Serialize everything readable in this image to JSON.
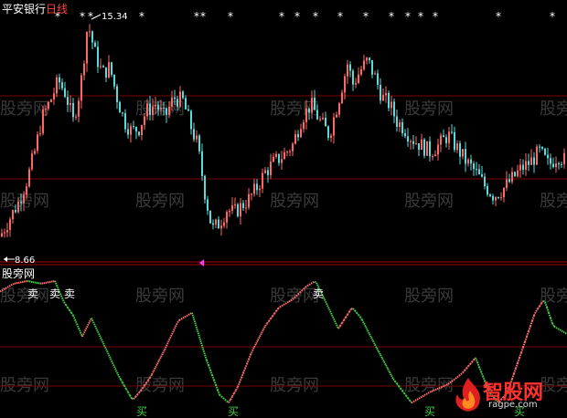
{
  "header": {
    "stock_name": "平安银行",
    "period": "日线",
    "stock_color": "#ffffff",
    "period_color": "#ff4040"
  },
  "upper_panel": {
    "high_label": "15.34",
    "low_label": "8.66",
    "price_range": [
      8.66,
      15.34
    ],
    "marker_symbol": "*",
    "candle_up_color": "#ff6666",
    "candle_down_color": "#55dddd",
    "gridline_color": "#7a0000"
  },
  "lower_panel": {
    "indicator_name": "股旁网",
    "buy_label": "买",
    "sell_label": "卖",
    "rise_color": "#ff7070",
    "fall_color": "#44cc44",
    "gridline_color": "#7a0000"
  },
  "watermark": {
    "text": "股旁网"
  },
  "logo": {
    "text": "智股网",
    "sub": "ragpe.com"
  },
  "chart_data": [
    {
      "type": "candlestick",
      "title": "平安银行 日线",
      "ylim": [
        8.66,
        15.34
      ],
      "annotations": [
        "15.34",
        "8.66"
      ],
      "x": [
        0,
        10,
        20,
        30,
        38,
        46,
        55,
        64,
        72,
        80,
        88,
        96,
        104,
        112,
        120,
        128,
        136,
        144,
        152,
        160,
        170,
        180,
        190,
        200,
        208,
        216,
        224,
        232,
        240,
        248,
        256,
        264,
        272,
        280,
        290,
        300,
        310,
        320,
        330,
        340,
        350,
        360,
        370,
        380,
        386,
        394,
        402,
        410,
        418,
        426,
        434,
        442,
        450,
        460,
        470,
        480,
        490,
        500,
        510,
        520,
        530,
        540,
        550,
        560,
        570,
        580,
        590,
        600,
        610,
        620
      ],
      "close": [
        8.9,
        9.4,
        9.9,
        10.6,
        11.4,
        12.4,
        12.9,
        13.5,
        13.1,
        12.3,
        13.3,
        15.2,
        14.3,
        13.7,
        13.9,
        13.0,
        12.3,
        12.0,
        12.1,
        12.6,
        12.8,
        12.4,
        13.0,
        12.9,
        12.2,
        11.6,
        10.2,
        9.1,
        9.3,
        9.7,
        9.6,
        9.8,
        10.0,
        10.3,
        10.8,
        11.1,
        11.3,
        11.6,
        12.4,
        12.8,
        12.3,
        11.9,
        12.9,
        14.0,
        13.4,
        13.8,
        14.1,
        13.6,
        13.0,
        12.8,
        12.3,
        12.1,
        11.8,
        11.6,
        11.4,
        11.6,
        11.9,
        11.5,
        11.1,
        10.8,
        10.4,
        10.1,
        10.3,
        10.6,
        10.9,
        11.1,
        11.4,
        11.0,
        11.3,
        11.1
      ],
      "markers_x": [
        63,
        90,
        99,
        155,
        215,
        222,
        252,
        308,
        325,
        345,
        372,
        400,
        428,
        446,
        460,
        476,
        545,
        604
      ]
    },
    {
      "type": "line",
      "title": "股旁网",
      "ylim": [
        0,
        100
      ],
      "x": [
        0,
        15,
        30,
        45,
        60,
        70,
        80,
        90,
        100,
        115,
        130,
        145,
        155,
        165,
        180,
        195,
        210,
        225,
        240,
        250,
        260,
        275,
        290,
        305,
        320,
        335,
        345,
        355,
        370,
        385,
        395,
        410,
        430,
        450,
        470,
        490,
        505,
        520,
        535,
        545,
        555,
        565,
        575,
        585,
        595,
        605,
        620
      ],
      "y": [
        90,
        96,
        98,
        96,
        98,
        82,
        72,
        56,
        70,
        48,
        26,
        8,
        16,
        26,
        46,
        68,
        74,
        40,
        12,
        6,
        18,
        44,
        64,
        78,
        84,
        94,
        98,
        84,
        62,
        78,
        70,
        50,
        24,
        6,
        14,
        20,
        28,
        40,
        14,
        6,
        14,
        34,
        54,
        74,
        84,
        64,
        58
      ],
      "buy_x": [
        155,
        255,
        470,
        568
      ],
      "sell_x": [
        36,
        60,
        76,
        348
      ]
    }
  ]
}
